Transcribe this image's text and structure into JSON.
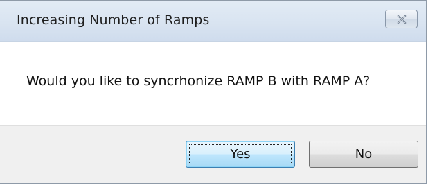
{
  "dialog": {
    "title": "Increasing Number of Ramps",
    "message": "Would you like to syncrhonize RAMP B with RAMP A?",
    "buttons": {
      "yes": {
        "mnemonic": "Y",
        "rest": "es"
      },
      "no": {
        "mnemonic": "N",
        "rest": "o"
      }
    },
    "close_icon": "close-icon"
  }
}
